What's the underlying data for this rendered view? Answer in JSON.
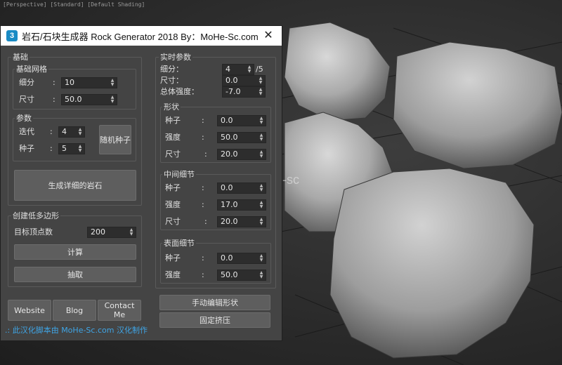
{
  "viewport": {
    "label": "[Perspective] [Standard] [Default Shading]",
    "watermark": "MoHe-sc"
  },
  "dialog": {
    "icon_text": "3",
    "title": "岩石/石块生成器 Rock Generator 2018 By：MoHe-Sc.com",
    "close": "✕"
  },
  "basic": {
    "label": "基础",
    "mesh": {
      "label": "基础网格",
      "subdiv_label": "细分",
      "subdiv": "10",
      "size_label": "尺寸",
      "size": "50.0"
    },
    "params": {
      "label": "参数",
      "iter_label": "迭代",
      "iter": "4",
      "seed_label": "种子",
      "seed": "5",
      "random_seed_btn": "随机种子"
    },
    "generate_btn": "生成详细的岩石"
  },
  "lowpoly": {
    "label": "创建低多边形",
    "target_label": "目标顶点数",
    "target": "200",
    "calc_btn": "计算",
    "extract_btn": "抽取"
  },
  "links": {
    "website": "Website",
    "blog": "Blog",
    "contact": "Contact Me"
  },
  "footer": ".: 此汉化脚本由 MoHe-Sc.com 汉化制作",
  "realtime": {
    "label": "实时参数",
    "subdiv_label": "细分：",
    "subdiv": "4",
    "subdiv_suffix": "/5",
    "size_label": "尺寸：",
    "size": "0.0",
    "strength_label": "总体强度：",
    "strength": "-7.0",
    "shape": {
      "label": "形状",
      "seed_label": "种子",
      "seed": "0.0",
      "strength_label": "强度",
      "strength": "50.0",
      "size_label": "尺寸",
      "size": "20.0"
    },
    "mid": {
      "label": "中间细节",
      "seed_label": "种子",
      "seed": "0.0",
      "strength_label": "强度",
      "strength": "17.0",
      "size_label": "尺寸",
      "size": "20.0"
    },
    "surface": {
      "label": "表面细节",
      "seed_label": "种子",
      "seed": "0.0",
      "strength_label": "强度",
      "strength": "50.0"
    },
    "edit_shape_btn": "手动编辑形状",
    "fix_btn": "固定挤压"
  },
  "colors": {
    "dialog_bg": "#444444",
    "field_bg": "#2d2d2d",
    "button_bg": "#5e5e5e",
    "link_blue": "#3fa5e6"
  }
}
